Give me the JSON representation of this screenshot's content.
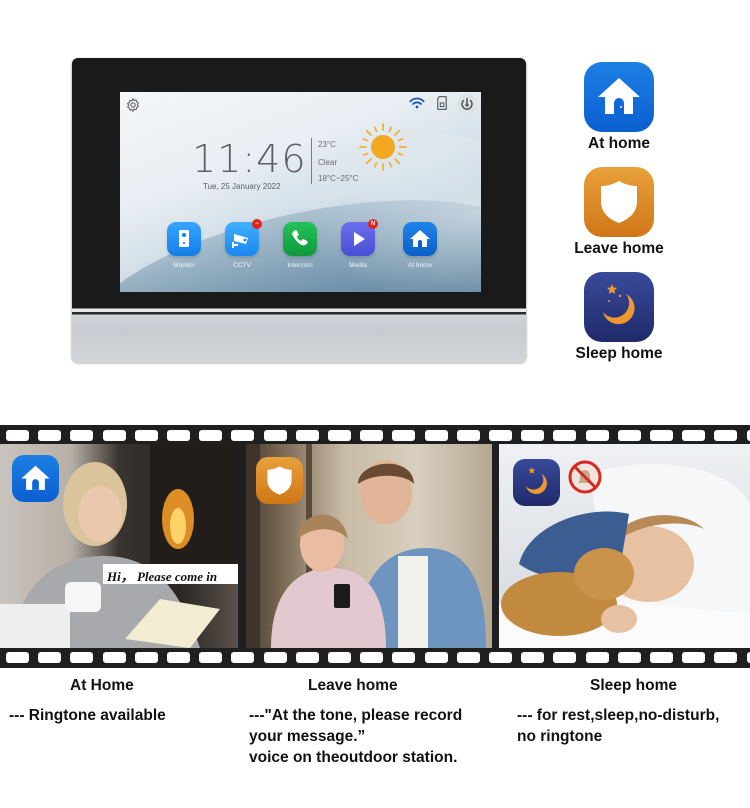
{
  "device": {
    "screen": {
      "status_icons": [
        "gear-icon",
        "wifi-icon",
        "sd-card-icon",
        "power-icon"
      ],
      "clock": {
        "time": "11:46",
        "date": "Tue, 25 January  2022"
      },
      "weather": {
        "temperature": "23°C",
        "condition": "Clear",
        "range": "18°C~25°C",
        "icon": "sun-icon"
      },
      "apps": [
        {
          "label": "Monitor",
          "icon": "doorbell-icon",
          "color": "#1a8cf0",
          "badge": null
        },
        {
          "label": "CCTV",
          "icon": "camera-icon",
          "color": "#2a98f0",
          "badge": "−"
        },
        {
          "label": "Intercom",
          "icon": "phone-icon",
          "color": "#19a64a",
          "badge": null
        },
        {
          "label": "Media",
          "icon": "play-icon",
          "color": "#5a5ee0",
          "badge": "N"
        },
        {
          "label": "At home",
          "icon": "home-icon",
          "color": "#0f6fd8",
          "badge": null
        }
      ]
    }
  },
  "modes": [
    {
      "label": "At home",
      "icon": "home-icon",
      "color": "#1577e0"
    },
    {
      "label": "Leave home",
      "icon": "shield-icon",
      "color": "#de8c28"
    },
    {
      "label": "Sleep home",
      "icon": "moon-icon",
      "color": "#2b3883"
    }
  ],
  "film": {
    "frames": [
      {
        "scene": "woman-reading-by-fireplace",
        "overlay_icon": "home-icon",
        "speech": "Hi， Please come in"
      },
      {
        "scene": "couple-looking-at-phone",
        "overlay_icon": "shield-icon"
      },
      {
        "scene": "boy-sleeping-with-teddy-bear",
        "overlay_icon": "moon-icon",
        "extra_icon": "mute-bell-icon"
      }
    ]
  },
  "captions": [
    {
      "title": "At Home",
      "text": "--- Ringtone available"
    },
    {
      "title": "Leave home",
      "text": "---\"At the tone, please record\nyour message.”\nvoice on theoutdoor station."
    },
    {
      "title": "Sleep home",
      "text": "--- for rest,sleep,no-disturb,\n no ringtone"
    }
  ]
}
